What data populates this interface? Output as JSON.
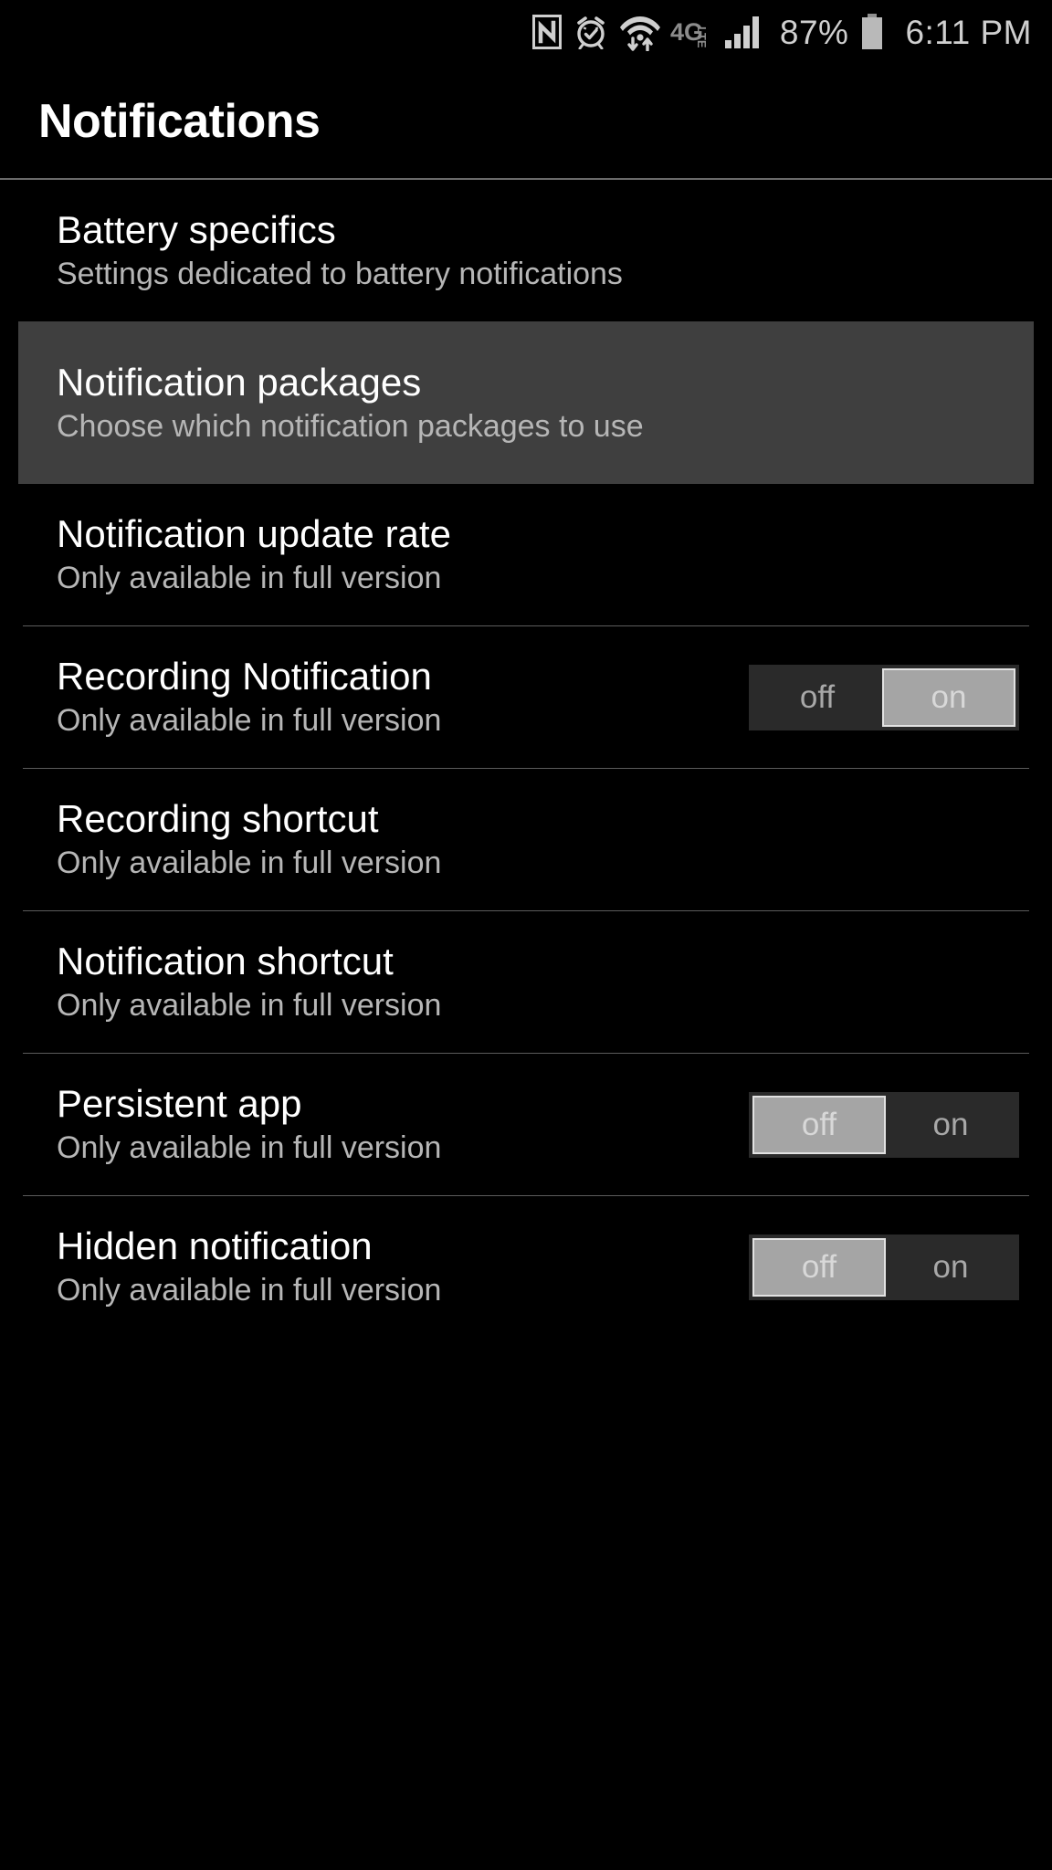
{
  "statusbar": {
    "icons": [
      "nfc-icon",
      "alarm-icon",
      "wifi-data-icon",
      "4glte-icon",
      "signal-icon",
      "battery-icon"
    ],
    "network_label": "4G",
    "network_sub": "LTE",
    "battery_percent": "87%",
    "time": "6:11 PM"
  },
  "header": {
    "title": "Notifications"
  },
  "toggle_labels": {
    "off": "off",
    "on": "on"
  },
  "list": {
    "items": [
      {
        "title": "Battery specifics",
        "subtitle": "Settings dedicated to battery notifications",
        "selected": false,
        "divider_above": false,
        "toggle": null
      },
      {
        "title": "Notification packages",
        "subtitle": "Choose which notification packages to use",
        "selected": true,
        "divider_above": false,
        "toggle": null
      },
      {
        "title": "Notification update rate",
        "subtitle": "Only available in full version",
        "selected": false,
        "divider_above": false,
        "toggle": null
      },
      {
        "title": "Recording Notification",
        "subtitle": "Only available in full version",
        "selected": false,
        "divider_above": true,
        "toggle": "on"
      },
      {
        "title": "Recording shortcut",
        "subtitle": "Only available in full version",
        "selected": false,
        "divider_above": true,
        "toggle": null
      },
      {
        "title": "Notification shortcut",
        "subtitle": "Only available in full version",
        "selected": false,
        "divider_above": true,
        "toggle": null
      },
      {
        "title": "Persistent app",
        "subtitle": "Only available in full version",
        "selected": false,
        "divider_above": true,
        "toggle": "off"
      },
      {
        "title": "Hidden notification",
        "subtitle": "Only available in full version",
        "selected": false,
        "divider_above": true,
        "toggle": "off"
      }
    ]
  },
  "colors": {
    "background": "#000000",
    "selected_row": "#3f3f3f",
    "divider": "#5c5c5c",
    "subtitle_text": "#b6b6b6",
    "toggle_track": "#2a2a2a",
    "toggle_active": "#a5a5a5"
  }
}
